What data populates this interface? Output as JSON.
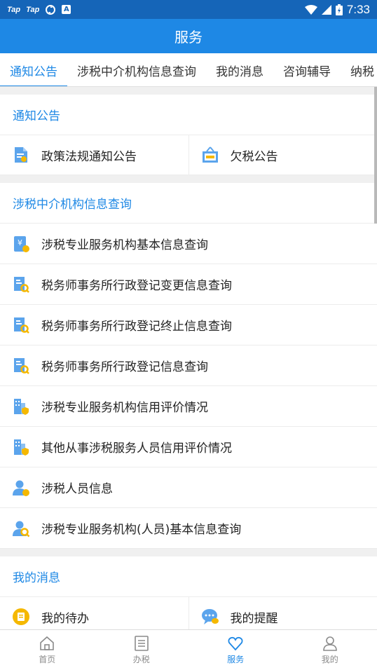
{
  "status_bar": {
    "left_items": [
      "Tap",
      "Tap"
    ],
    "a_badge": "A",
    "time": "7:33"
  },
  "header": {
    "title": "服务"
  },
  "tabs": [
    {
      "label": "通知公告",
      "active": true
    },
    {
      "label": "涉税中介机构信息查询",
      "active": false
    },
    {
      "label": "我的消息",
      "active": false
    },
    {
      "label": "咨询辅导",
      "active": false
    },
    {
      "label": "纳税",
      "active": false
    }
  ],
  "sections": {
    "notice": {
      "title": "通知公告",
      "items": [
        {
          "label": "政策法规通知公告",
          "icon": "policy-doc-icon"
        },
        {
          "label": "欠税公告",
          "icon": "tax-arrears-board-icon"
        }
      ]
    },
    "agency": {
      "title": "涉税中介机构信息查询",
      "items": [
        {
          "label": "涉税专业服务机构基本信息查询",
          "icon": "yen-doc-icon"
        },
        {
          "label": "税务师事务所行政登记变更信息查询",
          "icon": "doc-search-icon"
        },
        {
          "label": "税务师事务所行政登记终止信息查询",
          "icon": "doc-search-icon"
        },
        {
          "label": "税务师事务所行政登记信息查询",
          "icon": "doc-search-icon"
        },
        {
          "label": "涉税专业服务机构信用评价情况",
          "icon": "building-credit-icon"
        },
        {
          "label": "其他从事涉税服务人员信用评价情况",
          "icon": "building-credit-icon"
        },
        {
          "label": "涉税人员信息",
          "icon": "person-badge-icon"
        },
        {
          "label": "涉税专业服务机构(人员)基本信息查询",
          "icon": "person-search-icon"
        }
      ]
    },
    "messages": {
      "title": "我的消息",
      "items": [
        {
          "label": "我的待办",
          "icon": "todo-icon"
        },
        {
          "label": "我的提醒",
          "icon": "reminder-chat-icon"
        }
      ]
    }
  },
  "bottom_nav": [
    {
      "label": "首页",
      "icon": "home-icon",
      "active": false
    },
    {
      "label": "办税",
      "icon": "tax-list-icon",
      "active": false
    },
    {
      "label": "服务",
      "icon": "heart-service-icon",
      "active": true
    },
    {
      "label": "我的",
      "icon": "profile-icon",
      "active": false
    }
  ],
  "colors": {
    "status_bar": "#1565b8",
    "primary": "#1e88e5",
    "accent_yellow": "#f5b800",
    "background": "#f0f0f0"
  }
}
